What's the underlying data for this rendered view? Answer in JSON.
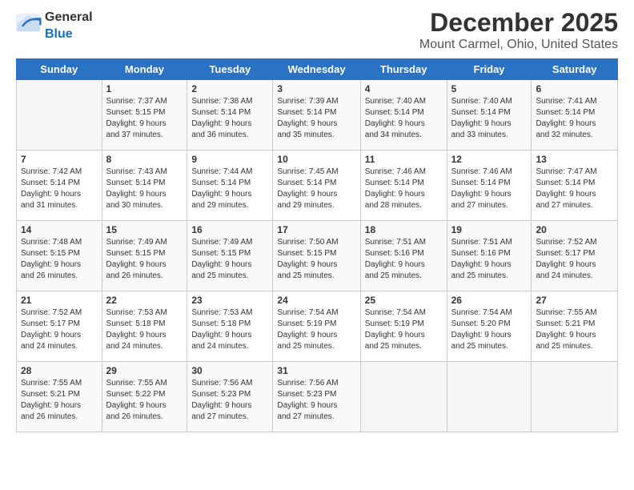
{
  "header": {
    "logo_general": "General",
    "logo_blue": "Blue",
    "month": "December 2025",
    "location": "Mount Carmel, Ohio, United States"
  },
  "days_of_week": [
    "Sunday",
    "Monday",
    "Tuesday",
    "Wednesday",
    "Thursday",
    "Friday",
    "Saturday"
  ],
  "weeks": [
    [
      {
        "day": "",
        "info": ""
      },
      {
        "day": "1",
        "info": "Sunrise: 7:37 AM\nSunset: 5:15 PM\nDaylight: 9 hours\nand 37 minutes."
      },
      {
        "day": "2",
        "info": "Sunrise: 7:38 AM\nSunset: 5:14 PM\nDaylight: 9 hours\nand 36 minutes."
      },
      {
        "day": "3",
        "info": "Sunrise: 7:39 AM\nSunset: 5:14 PM\nDaylight: 9 hours\nand 35 minutes."
      },
      {
        "day": "4",
        "info": "Sunrise: 7:40 AM\nSunset: 5:14 PM\nDaylight: 9 hours\nand 34 minutes."
      },
      {
        "day": "5",
        "info": "Sunrise: 7:40 AM\nSunset: 5:14 PM\nDaylight: 9 hours\nand 33 minutes."
      },
      {
        "day": "6",
        "info": "Sunrise: 7:41 AM\nSunset: 5:14 PM\nDaylight: 9 hours\nand 32 minutes."
      }
    ],
    [
      {
        "day": "7",
        "info": "Sunrise: 7:42 AM\nSunset: 5:14 PM\nDaylight: 9 hours\nand 31 minutes."
      },
      {
        "day": "8",
        "info": "Sunrise: 7:43 AM\nSunset: 5:14 PM\nDaylight: 9 hours\nand 30 minutes."
      },
      {
        "day": "9",
        "info": "Sunrise: 7:44 AM\nSunset: 5:14 PM\nDaylight: 9 hours\nand 29 minutes."
      },
      {
        "day": "10",
        "info": "Sunrise: 7:45 AM\nSunset: 5:14 PM\nDaylight: 9 hours\nand 29 minutes."
      },
      {
        "day": "11",
        "info": "Sunrise: 7:46 AM\nSunset: 5:14 PM\nDaylight: 9 hours\nand 28 minutes."
      },
      {
        "day": "12",
        "info": "Sunrise: 7:46 AM\nSunset: 5:14 PM\nDaylight: 9 hours\nand 27 minutes."
      },
      {
        "day": "13",
        "info": "Sunrise: 7:47 AM\nSunset: 5:14 PM\nDaylight: 9 hours\nand 27 minutes."
      }
    ],
    [
      {
        "day": "14",
        "info": "Sunrise: 7:48 AM\nSunset: 5:15 PM\nDaylight: 9 hours\nand 26 minutes."
      },
      {
        "day": "15",
        "info": "Sunrise: 7:49 AM\nSunset: 5:15 PM\nDaylight: 9 hours\nand 26 minutes."
      },
      {
        "day": "16",
        "info": "Sunrise: 7:49 AM\nSunset: 5:15 PM\nDaylight: 9 hours\nand 25 minutes."
      },
      {
        "day": "17",
        "info": "Sunrise: 7:50 AM\nSunset: 5:15 PM\nDaylight: 9 hours\nand 25 minutes."
      },
      {
        "day": "18",
        "info": "Sunrise: 7:51 AM\nSunset: 5:16 PM\nDaylight: 9 hours\nand 25 minutes."
      },
      {
        "day": "19",
        "info": "Sunrise: 7:51 AM\nSunset: 5:16 PM\nDaylight: 9 hours\nand 25 minutes."
      },
      {
        "day": "20",
        "info": "Sunrise: 7:52 AM\nSunset: 5:17 PM\nDaylight: 9 hours\nand 24 minutes."
      }
    ],
    [
      {
        "day": "21",
        "info": "Sunrise: 7:52 AM\nSunset: 5:17 PM\nDaylight: 9 hours\nand 24 minutes."
      },
      {
        "day": "22",
        "info": "Sunrise: 7:53 AM\nSunset: 5:18 PM\nDaylight: 9 hours\nand 24 minutes."
      },
      {
        "day": "23",
        "info": "Sunrise: 7:53 AM\nSunset: 5:18 PM\nDaylight: 9 hours\nand 24 minutes."
      },
      {
        "day": "24",
        "info": "Sunrise: 7:54 AM\nSunset: 5:19 PM\nDaylight: 9 hours\nand 25 minutes."
      },
      {
        "day": "25",
        "info": "Sunrise: 7:54 AM\nSunset: 5:19 PM\nDaylight: 9 hours\nand 25 minutes."
      },
      {
        "day": "26",
        "info": "Sunrise: 7:54 AM\nSunset: 5:20 PM\nDaylight: 9 hours\nand 25 minutes."
      },
      {
        "day": "27",
        "info": "Sunrise: 7:55 AM\nSunset: 5:21 PM\nDaylight: 9 hours\nand 25 minutes."
      }
    ],
    [
      {
        "day": "28",
        "info": "Sunrise: 7:55 AM\nSunset: 5:21 PM\nDaylight: 9 hours\nand 26 minutes."
      },
      {
        "day": "29",
        "info": "Sunrise: 7:55 AM\nSunset: 5:22 PM\nDaylight: 9 hours\nand 26 minutes."
      },
      {
        "day": "30",
        "info": "Sunrise: 7:56 AM\nSunset: 5:23 PM\nDaylight: 9 hours\nand 27 minutes."
      },
      {
        "day": "31",
        "info": "Sunrise: 7:56 AM\nSunset: 5:23 PM\nDaylight: 9 hours\nand 27 minutes."
      },
      {
        "day": "",
        "info": ""
      },
      {
        "day": "",
        "info": ""
      },
      {
        "day": "",
        "info": ""
      }
    ]
  ]
}
